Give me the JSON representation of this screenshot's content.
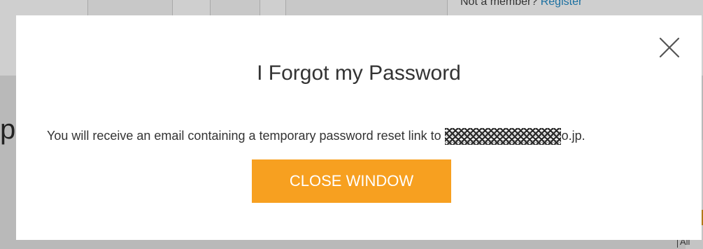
{
  "background": {
    "member_prompt": "Not a member?",
    "register_link": "Register",
    "left_fragment_large": "p",
    "left_fragment_small": "",
    "right_fragment_bottom": "All"
  },
  "modal": {
    "title": "I Forgot my Password",
    "message_before": "You will receive an email containing a temporary password reset link to",
    "email_suffix": "o.jp.",
    "close_icon": "close-icon",
    "button_label": "CLOSE WINDOW"
  },
  "colors": {
    "button_bg": "#f7a020",
    "link": "#1a6fa0",
    "overlay": "#b9b9b9"
  }
}
